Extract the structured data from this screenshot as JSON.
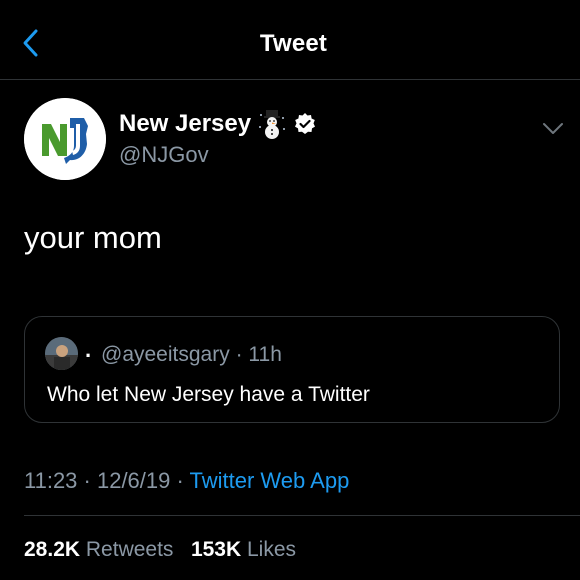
{
  "header": {
    "title": "Tweet",
    "back_icon": "chevron-left-icon"
  },
  "author": {
    "name": "New Jersey",
    "handle": "@NJGov",
    "emoji_icon": "snowman-icon",
    "verified_icon": "verified-badge-icon",
    "avatar_text": "NJ"
  },
  "tweet": {
    "text": "your mom"
  },
  "quoted": {
    "separator": ".",
    "handle": "@ayeeitsgary",
    "time": "· 11h",
    "text": "Who let New Jersey have a Twitter"
  },
  "meta": {
    "timestamp": "11:23 · 12/6/19 ·",
    "source": "Twitter Web App"
  },
  "stats": {
    "retweets_count": "28.2K",
    "retweets_label": "Retweets",
    "likes_count": "153K",
    "likes_label": "Likes"
  },
  "colors": {
    "background": "#000000",
    "accent": "#1d9bf0",
    "secondary_text": "#8b98a5",
    "border": "#2f3336",
    "nj_green": "#4a9a2e",
    "nj_blue": "#1f5ea8"
  }
}
